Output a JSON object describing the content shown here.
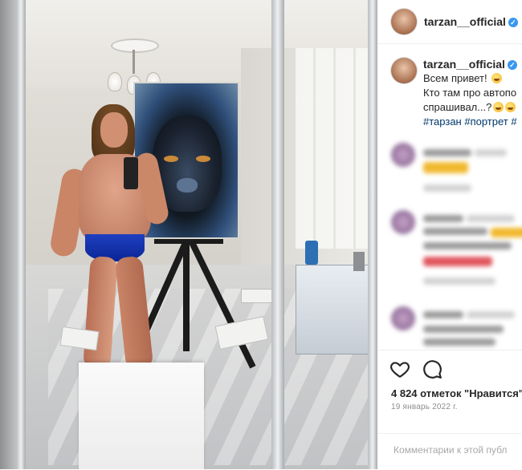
{
  "post": {
    "photo_alt": "",
    "header": {
      "username": "tarzan__official",
      "verified_badge": "verified-icon"
    },
    "caption": {
      "username": "tarzan__official",
      "line1": "Всем привет!",
      "line2": "Кто там про автопо",
      "line3": "спрашивал...?",
      "hashtags": "#тарзан #портрет #"
    },
    "likes_text": "4 824 отметок \"Нравится\"",
    "date_text": "19 январь 2022 г.",
    "comment_placeholder": "Комментарии к этой публ",
    "icons": {
      "like": "heart-icon",
      "comment": "comment-bubble-icon",
      "verified": "check-badge-icon"
    },
    "colors": {
      "verified": "#3897f0",
      "hashtag": "#00376b",
      "text": "#262626",
      "muted": "#8e8e8e"
    }
  }
}
